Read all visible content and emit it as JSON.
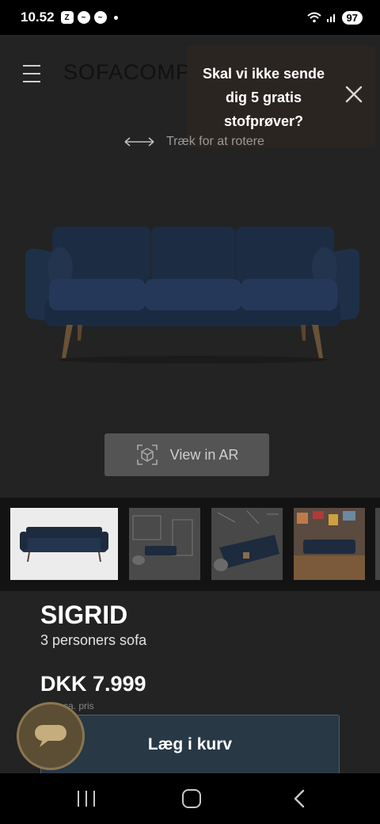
{
  "status_bar": {
    "time": "10.52",
    "icons": [
      "calendar-icon",
      "messenger-icon",
      "messenger-icon",
      "notification-dot"
    ],
    "battery": "97"
  },
  "header": {
    "logo": "SOFACOMPA",
    "menu_icon": "hamburger-icon"
  },
  "popup": {
    "message": "Skal vi ikke sende dig 5 gratis stofprøver?",
    "close_icon": "close-icon"
  },
  "viewer": {
    "rotate_hint": "Træk for at rotere",
    "ar_button": "View in AR"
  },
  "thumbnails": [
    {
      "label": "sofa-studio-thumbnail"
    },
    {
      "label": "sofa-room-sketch-thumbnail"
    },
    {
      "label": "sofa-side-sketch-thumbnail"
    },
    {
      "label": "sofa-living-room-thumbnail"
    }
  ],
  "product": {
    "name": "SIGRID",
    "subtitle": "3 personers sofa",
    "price": "DKK 7.999",
    "price_note": "ca. pris"
  },
  "actions": {
    "add_to_cart": "Læg i kurv"
  },
  "colors": {
    "page_bg": "#232323",
    "sofa": "#1f3048",
    "cart_button": "#283845",
    "chat_button": "#5c4e34"
  }
}
